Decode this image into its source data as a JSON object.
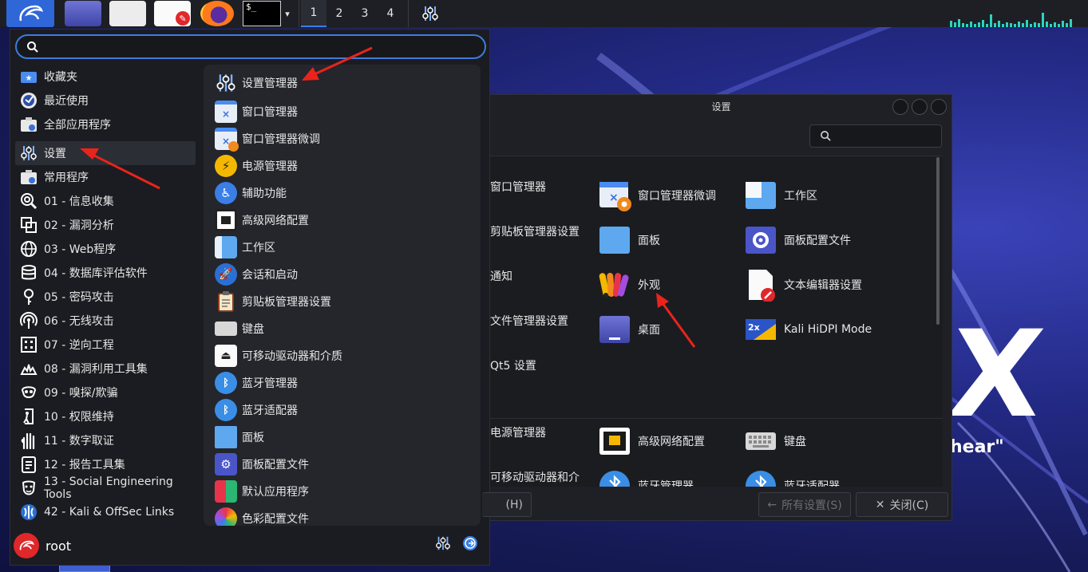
{
  "colors": {
    "accent": "#3c7be0",
    "annotation_arrow": "#e8241c",
    "panel_bg": "#1d1f24",
    "menu_bg": "#1b1c21"
  },
  "top_panel": {
    "launchers": [
      {
        "icon": "kali-menu-icon"
      },
      {
        "icon": "show-desktop-icon"
      },
      {
        "icon": "file-manager-icon"
      },
      {
        "icon": "text-editor-icon"
      },
      {
        "icon": "firefox-icon"
      },
      {
        "icon": "terminal-icon",
        "text": "$_"
      }
    ],
    "workspaces": [
      "1",
      "2",
      "3",
      "4"
    ],
    "active_workspace": "1"
  },
  "menu": {
    "search_value": "",
    "categories": [
      {
        "label": "收藏夹",
        "icon": "star-folder-icon"
      },
      {
        "label": "最近使用",
        "icon": "recent-icon"
      },
      {
        "label": "全部应用程序",
        "icon": "all-apps-icon"
      },
      {
        "label": "设置",
        "icon": "settings-sliders-icon"
      },
      {
        "label": "常用程序",
        "icon": "usual-apps-icon"
      },
      {
        "label": "01 - 信息收集",
        "icon": "info-gathering-icon"
      },
      {
        "label": "02 - 漏洞分析",
        "icon": "vuln-analysis-icon"
      },
      {
        "label": "03 - Web程序",
        "icon": "web-apps-icon"
      },
      {
        "label": "04 - 数据库评估软件",
        "icon": "database-icon"
      },
      {
        "label": "05 - 密码攻击",
        "icon": "password-icon"
      },
      {
        "label": "06 - 无线攻击",
        "icon": "wireless-icon"
      },
      {
        "label": "07 - 逆向工程",
        "icon": "reverse-eng-icon"
      },
      {
        "label": "08 - 漏洞利用工具集",
        "icon": "exploit-icon"
      },
      {
        "label": "09 - 嗅探/欺骗",
        "icon": "sniffing-icon"
      },
      {
        "label": "10 - 权限维持",
        "icon": "post-exploit-icon"
      },
      {
        "label": "11 - 数字取证",
        "icon": "forensics-icon"
      },
      {
        "label": "12 - 报告工具集",
        "icon": "reporting-icon"
      },
      {
        "label": "13 - Social Engineering Tools",
        "icon": "social-eng-icon"
      },
      {
        "label": "42 - Kali & OffSec Links",
        "icon": "kali-links-icon"
      }
    ],
    "apps": [
      {
        "label": "设置管理器",
        "icon": "settings-manager-icon"
      },
      {
        "label": "窗口管理器",
        "icon": "window-manager-icon"
      },
      {
        "label": "窗口管理器微调",
        "icon": "window-tweaks-icon"
      },
      {
        "label": "电源管理器",
        "icon": "power-manager-icon"
      },
      {
        "label": "辅助功能",
        "icon": "accessibility-icon"
      },
      {
        "label": "高级网络配置",
        "icon": "network-icon"
      },
      {
        "label": "工作区",
        "icon": "workspaces-icon"
      },
      {
        "label": "会话和启动",
        "icon": "session-startup-icon"
      },
      {
        "label": "剪贴板管理器设置",
        "icon": "clipboard-icon"
      },
      {
        "label": "键盘",
        "icon": "keyboard-icon"
      },
      {
        "label": "可移动驱动器和介质",
        "icon": "removable-drives-icon"
      },
      {
        "label": "蓝牙管理器",
        "icon": "bluetooth-icon"
      },
      {
        "label": "蓝牙适配器",
        "icon": "bluetooth-icon"
      },
      {
        "label": "面板",
        "icon": "panel-icon"
      },
      {
        "label": "面板配置文件",
        "icon": "panel-profiles-icon"
      },
      {
        "label": "默认应用程序",
        "icon": "default-apps-icon"
      },
      {
        "label": "色彩配置文件",
        "icon": "color-profiles-icon"
      }
    ],
    "user": "root"
  },
  "settings_window": {
    "title": "设置",
    "search_value": "",
    "items": [
      {
        "label": "窗口管理器",
        "icon": "window-manager-icon"
      },
      {
        "label": "窗口管理器微调",
        "icon": "window-tweaks-icon"
      },
      {
        "label": "工作区",
        "icon": "workspaces-icon"
      },
      {
        "label": "剪贴板管理器设置",
        "icon": "clipboard-icon"
      },
      {
        "label": "面板",
        "icon": "panel-icon"
      },
      {
        "label": "面板配置文件",
        "icon": "panel-profiles-icon"
      },
      {
        "label": "通知",
        "icon": "notifications-icon"
      },
      {
        "label": "外观",
        "icon": "appearance-icon"
      },
      {
        "label": "文本编辑器设置",
        "icon": "text-editor-icon"
      },
      {
        "label": "文件管理器设置",
        "icon": "file-manager-icon"
      },
      {
        "label": "桌面",
        "icon": "desktop-icon"
      },
      {
        "label": "Kali HiDPI Mode",
        "icon": "hidpi-icon"
      },
      {
        "label": "Qt5 设置",
        "icon": "qt5-icon"
      },
      {
        "label": "电源管理器",
        "icon": "power-manager-icon"
      },
      {
        "label": "高级网络配置",
        "icon": "network-icon"
      },
      {
        "label": "键盘",
        "icon": "keyboard-icon"
      },
      {
        "label": "可移动驱动器和介",
        "icon": "removable-drives-icon"
      },
      {
        "label": "蓝牙管理器",
        "icon": "bluetooth-icon"
      },
      {
        "label": "蓝牙适配器",
        "icon": "bluetooth-icon"
      }
    ],
    "help_button": "帮助(H)",
    "help_button_visible": "(H)",
    "all_settings_button": "所有设置(S)",
    "close_button": "关闭(C)"
  },
  "wallpaper": {
    "letter": "X",
    "quote": "hear\""
  }
}
